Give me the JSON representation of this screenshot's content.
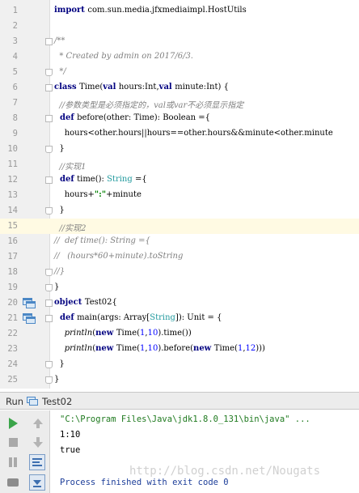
{
  "editor": {
    "lines": [
      {
        "n": "1",
        "tokens": [
          {
            "t": "import ",
            "c": "kw"
          },
          {
            "t": "com.sun.media.jfxmediaimpl.HostUtils",
            "c": ""
          }
        ]
      },
      {
        "n": "2",
        "tokens": []
      },
      {
        "n": "3",
        "tokens": [
          {
            "t": "/**",
            "c": "cmt"
          }
        ]
      },
      {
        "n": "4",
        "tokens": [
          {
            "t": "  * Created by admin on 2017/6/3.",
            "c": "cmt"
          }
        ]
      },
      {
        "n": "5",
        "tokens": [
          {
            "t": "  */",
            "c": "cmt"
          }
        ]
      },
      {
        "n": "6",
        "tokens": [
          {
            "t": "class ",
            "c": "kw"
          },
          {
            "t": "Time(",
            "c": ""
          },
          {
            "t": "val ",
            "c": "kw"
          },
          {
            "t": "hours:Int,",
            "c": ""
          },
          {
            "t": "val ",
            "c": "kw"
          },
          {
            "t": "minute:Int) {",
            "c": ""
          }
        ]
      },
      {
        "n": "7",
        "tokens": [
          {
            "t": "  //参数类型是必须指定的，val或var不必须显示指定",
            "c": "cmt"
          }
        ]
      },
      {
        "n": "8",
        "tokens": [
          {
            "t": "  def ",
            "c": "kw"
          },
          {
            "t": "before(other: Time): Boolean ={",
            "c": ""
          }
        ]
      },
      {
        "n": "9",
        "tokens": [
          {
            "t": "    hours<other.hours||hours==other.hours&&minute<other.minute",
            "c": ""
          }
        ]
      },
      {
        "n": "10",
        "tokens": [
          {
            "t": "  }",
            "c": ""
          }
        ]
      },
      {
        "n": "11",
        "tokens": [
          {
            "t": "  //实现1",
            "c": "cmt"
          }
        ]
      },
      {
        "n": "12",
        "tokens": [
          {
            "t": "  def ",
            "c": "kw"
          },
          {
            "t": "time(): ",
            "c": ""
          },
          {
            "t": "String",
            "c": "type"
          },
          {
            "t": " ={",
            "c": ""
          }
        ]
      },
      {
        "n": "13",
        "tokens": [
          {
            "t": "    hours+",
            "c": ""
          },
          {
            "t": "\":\"",
            "c": "str"
          },
          {
            "t": "+minute",
            "c": ""
          }
        ]
      },
      {
        "n": "14",
        "tokens": [
          {
            "t": "  }",
            "c": ""
          }
        ]
      },
      {
        "n": "15",
        "tokens": [
          {
            "t": "  //实现2",
            "c": "cmt"
          }
        ]
      },
      {
        "n": "16",
        "tokens": [
          {
            "t": "//  def time(): String ={",
            "c": "cmt"
          }
        ]
      },
      {
        "n": "17",
        "tokens": [
          {
            "t": "//   (hours*60+minute).toString",
            "c": "cmt"
          }
        ]
      },
      {
        "n": "18",
        "tokens": [
          {
            "t": "//}",
            "c": "cmt"
          }
        ]
      },
      {
        "n": "19",
        "tokens": [
          {
            "t": "}",
            "c": ""
          }
        ]
      },
      {
        "n": "20",
        "tokens": [
          {
            "t": "object ",
            "c": "kw"
          },
          {
            "t": "Test02{",
            "c": ""
          }
        ]
      },
      {
        "n": "21",
        "tokens": [
          {
            "t": "  def ",
            "c": "kw"
          },
          {
            "t": "main(args: Array[",
            "c": ""
          },
          {
            "t": "String",
            "c": "type"
          },
          {
            "t": "]): Unit = {",
            "c": ""
          }
        ]
      },
      {
        "n": "22",
        "tokens": [
          {
            "t": "    ",
            "c": ""
          },
          {
            "t": "println",
            "c": "fn"
          },
          {
            "t": "(",
            "c": ""
          },
          {
            "t": "new ",
            "c": "kw"
          },
          {
            "t": "Time(",
            "c": ""
          },
          {
            "t": "1",
            "c": "num"
          },
          {
            "t": ",",
            "c": ""
          },
          {
            "t": "10",
            "c": "num"
          },
          {
            "t": ").time())",
            "c": ""
          }
        ]
      },
      {
        "n": "23",
        "tokens": [
          {
            "t": "    ",
            "c": ""
          },
          {
            "t": "println",
            "c": "fn"
          },
          {
            "t": "(",
            "c": ""
          },
          {
            "t": "new ",
            "c": "kw"
          },
          {
            "t": "Time(",
            "c": ""
          },
          {
            "t": "1",
            "c": "num"
          },
          {
            "t": ",",
            "c": ""
          },
          {
            "t": "10",
            "c": "num"
          },
          {
            "t": ").before(",
            "c": ""
          },
          {
            "t": "new ",
            "c": "kw"
          },
          {
            "t": "Time(",
            "c": ""
          },
          {
            "t": "1",
            "c": "num"
          },
          {
            "t": ",",
            "c": ""
          },
          {
            "t": "12",
            "c": "num"
          },
          {
            "t": ")))",
            "c": ""
          }
        ]
      },
      {
        "n": "24",
        "tokens": [
          {
            "t": "  }",
            "c": ""
          }
        ]
      },
      {
        "n": "25",
        "tokens": [
          {
            "t": "}",
            "c": ""
          }
        ]
      }
    ],
    "current_line": "15"
  },
  "run_panel": {
    "label": "Run",
    "tab_name": "Test02",
    "console": [
      {
        "text": "\"C:\\Program Files\\Java\\jdk1.8.0_131\\bin\\java\" ...",
        "kind": "cmd"
      },
      {
        "text": "1:10",
        "kind": "out"
      },
      {
        "text": "true",
        "kind": "out"
      },
      {
        "text": "",
        "kind": "out"
      },
      {
        "text": "Process finished with exit code 0",
        "kind": "exit"
      }
    ]
  },
  "watermark": "http://blog.csdn.net/Nougats",
  "colors": {
    "keyword": "#000080",
    "comment": "#808080",
    "string": "#008000",
    "number": "#0000ff",
    "current_line": "#fffae3"
  }
}
